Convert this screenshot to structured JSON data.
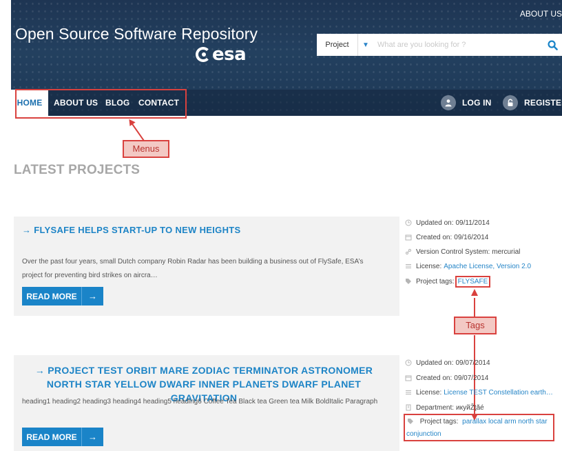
{
  "header": {
    "site_title": "Open Source Software Repository",
    "logo_text": "esa",
    "top_link": "ABOUT US",
    "search": {
      "category": "Project",
      "placeholder": "What are you looking for ?"
    }
  },
  "nav": {
    "items": [
      {
        "label": "HOME",
        "active": true
      },
      {
        "label": "ABOUT US"
      },
      {
        "label": "BLOG"
      },
      {
        "label": "CONTACT"
      }
    ],
    "login": "LOG IN",
    "register": "REGISTER"
  },
  "annotations": {
    "menus": "Menus",
    "tags": "Tags"
  },
  "section_title": "LATEST PROJECTS",
  "projects": [
    {
      "title": "→ FLYSAFE HELPS START-UP TO NEW HEIGHTS",
      "body": "Over the past four years, small Dutch company Robin Radar has been building a business out of FlySafe, ESA’s project for preventing bird strikes on aircra…",
      "read_more": "READ MORE",
      "meta": {
        "updated_label": "Updated on:",
        "updated_value": "09/11/2014",
        "created_label": "Created on:",
        "created_value": "09/16/2014",
        "vcs_label": "Version Control System:",
        "vcs_value": "mercurial",
        "license_label": "License:",
        "license_value": "Apache License, Version 2.0",
        "tags_label": "Project tags:",
        "tags_value": "FLYSAFE"
      }
    },
    {
      "title": "→ PROJECT TEST ORBIT MARE ZODIAC TERMINATOR ASTRONOMER NORTH STAR YELLOW DWARF INNER PLANETS DWARF PLANET GRAVITATION",
      "body": "heading1 heading2 heading3 heading4 heading5 heading6 Coffee Tea Black tea Green tea Milk BoldItalic Paragraph",
      "read_more": "READ MORE",
      "meta": {
        "updated_label": "Updated on:",
        "updated_value": "09/07/2014",
        "created_label": "Created on:",
        "created_value": "09/07/2014",
        "license_label": "License:",
        "license_value": "License TEST Constellation earth…",
        "department_label": "Department:",
        "department_value": "икуйŽţăé",
        "tags_label": "Project tags:",
        "tags_value": "parallax local arm north star conjunction"
      }
    }
  ],
  "colors": {
    "accent": "#1d84c6",
    "header_bg": "#23405f",
    "annotation": "#d9413e"
  },
  "icons": [
    "search-icon",
    "chevron-down-icon",
    "user-icon",
    "lock-icon",
    "arrow-right-icon",
    "clock-icon",
    "calendar-icon",
    "branch-icon",
    "list-icon",
    "building-icon",
    "tag-icon"
  ]
}
